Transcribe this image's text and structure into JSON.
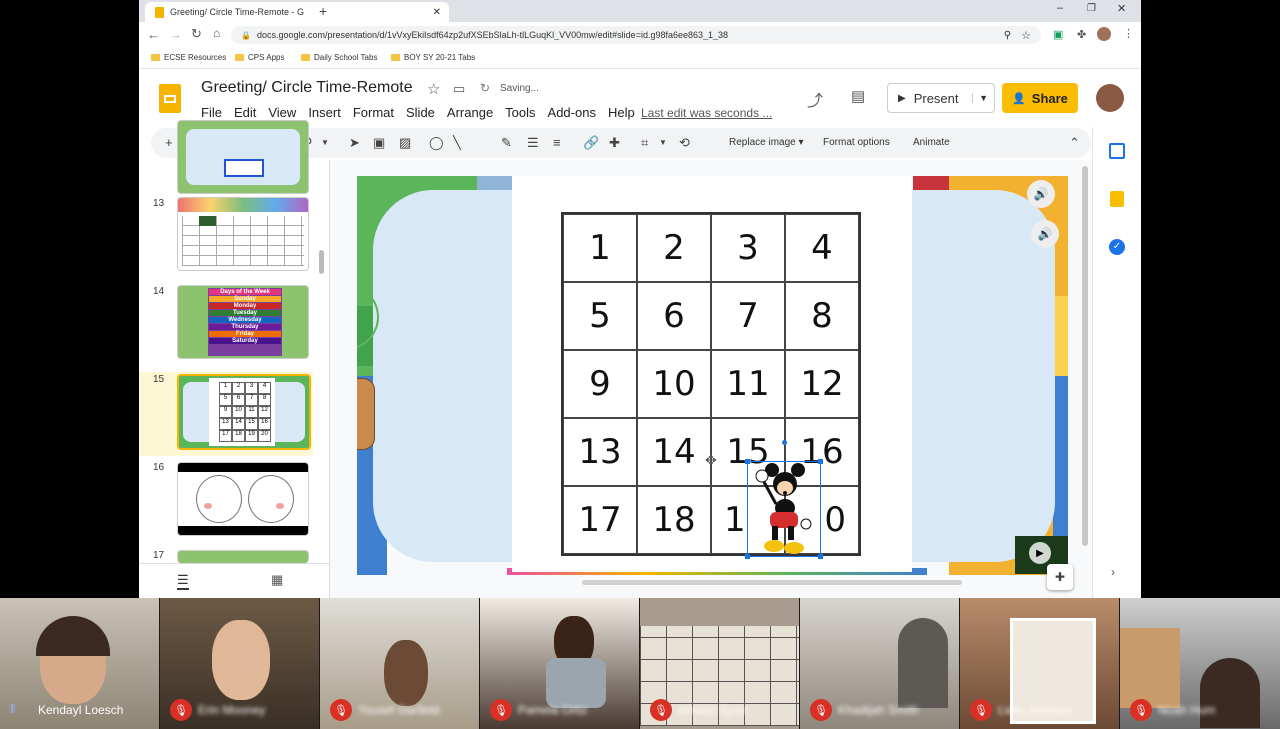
{
  "browser": {
    "tab_title": "Greeting/ Circle Time-Remote - G",
    "url": "docs.google.com/presentation/d/1vVxyEkiIsdf64zp2ufXSEbSlaLh-tlLGuqKl_VV00mw/edit#slide=id.g98fa6ee863_1_38",
    "bookmarks": [
      "ECSE Resources",
      "CPS Apps",
      "Daily School Tabs",
      "BOY SY 20-21 Tabs"
    ]
  },
  "doc": {
    "title": "Greeting/ Circle Time-Remote",
    "saving": "Saving...",
    "last_edit": "Last edit was seconds ...",
    "menu": [
      "File",
      "Edit",
      "View",
      "Insert",
      "Format",
      "Slide",
      "Arrange",
      "Tools",
      "Add-ons",
      "Help"
    ],
    "present_label": "Present",
    "share_label": "Share"
  },
  "toolbar": {
    "replace_image": "Replace image",
    "format_options": "Format options",
    "animate": "Animate"
  },
  "sidebar": {
    "slide_numbers": [
      "13",
      "14",
      "15",
      "16",
      "17"
    ],
    "days_title": "Days of the Week",
    "days": [
      "Sunday",
      "Monday",
      "Tuesday",
      "Wednesday",
      "Thursday",
      "Friday",
      "Saturday"
    ],
    "mini_numbers": [
      "1",
      "2",
      "3",
      "4",
      "5",
      "6",
      "7",
      "8",
      "9",
      "10",
      "11",
      "12",
      "13",
      "14",
      "15",
      "16",
      "17",
      "18",
      "19",
      "20"
    ]
  },
  "slide": {
    "numbers": [
      "1",
      "2",
      "3",
      "4",
      "5",
      "6",
      "7",
      "8",
      "9",
      "10",
      "11",
      "12",
      "13",
      "14",
      "15",
      "16",
      "17",
      "18",
      "1",
      "0"
    ]
  },
  "meet": {
    "participants": [
      "Kendayl Loesch",
      "Erin Mooney",
      "Yousef Garfield",
      "Pamela Ortiz",
      "Arbaaz Syed",
      "Khadijah Smith",
      "Liam Johnson",
      "Noah Hum"
    ]
  },
  "colors": {
    "share": "#fbbc04",
    "slides_logo": "#f4b400",
    "selection": "#1a73e8"
  }
}
